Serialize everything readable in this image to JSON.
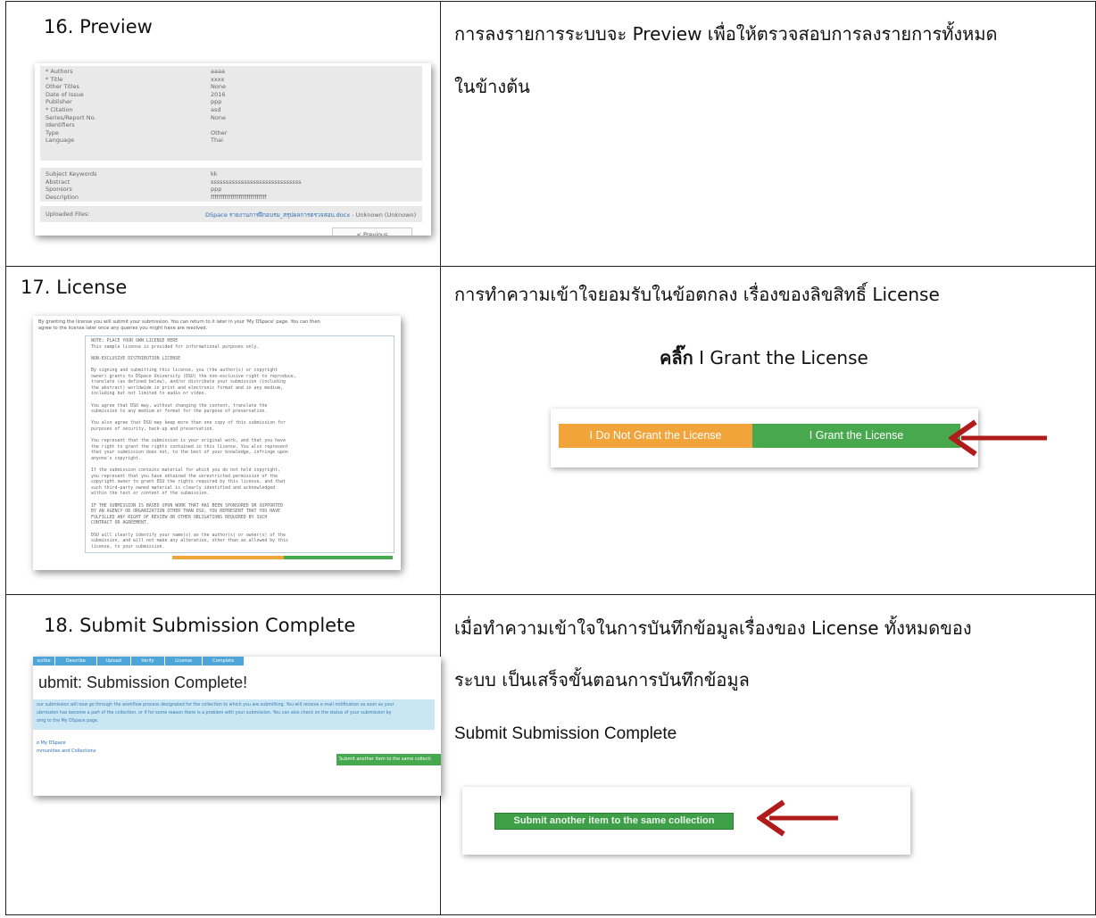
{
  "steps": [
    {
      "title": "16. Preview",
      "desc_lines": [
        "การลงรายการระบบจะ Preview เพื่อให้ตรวจสอบการลงรายการทั้งหมด",
        "ในข้างต้น"
      ],
      "preview": {
        "fields_a": [
          {
            "label": "* Authors",
            "value": "aaaa"
          },
          {
            "label": "* Title",
            "value": "xxxx"
          },
          {
            "label": "Other Titles",
            "value": "None"
          },
          {
            "label": "Date of Issue",
            "value": "2016"
          },
          {
            "label": "Publisher",
            "value": "ppp"
          },
          {
            "label": "* Citation",
            "value": "asd"
          },
          {
            "label": "Series/Report No.",
            "value": "None"
          },
          {
            "label": "Identifiers",
            "value": ""
          },
          {
            "label": "Type",
            "value": "Other"
          },
          {
            "label": "Language",
            "value": "Thai"
          }
        ],
        "fields_b": [
          {
            "label": "Subject Keywords",
            "value": "kk"
          },
          {
            "label": "Abstract",
            "value": "ssssssssssssssssssssssssssssss"
          },
          {
            "label": "Sponsors",
            "value": "ppp"
          },
          {
            "label": "Description",
            "value": "ffffffffffffffffffffffffffff"
          }
        ],
        "uploaded_label": "Uploaded Files:",
        "uploaded_file": "DSpace รายงานการฝึกอบรม_สรุปผลการตรวจสอบ.docx",
        "uploaded_status": " - Unknown (Unknown)",
        "previous_button": "< Previous"
      }
    },
    {
      "title": "17. License",
      "desc": "การทำความเข้าใจยอมรับในข้อตกลง เรื่องของลิขสิทธิ์ License",
      "click_bold": "คลิ๊ก",
      "click_rest": " I Grant the License",
      "license": {
        "intro": [
          "By granting the license you will submit your submission. You can return to it later in your 'My DSpace' page. You can then",
          "agree to the license later once any queries you might have are resolved."
        ],
        "text": [
          "NOTE: PLACE YOUR OWN LICENSE HERE",
          "This sample license is provided for informational purposes only.",
          "",
          "NON-EXCLUSIVE DISTRIBUTION LICENSE",
          "",
          "By signing and submitting this license, you (the author(s) or copyright",
          "owner) grants to DSpace University (DSU) the non-exclusive right to reproduce,",
          "translate (as defined below), and/or distribute your submission (including",
          "the abstract) worldwide in print and electronic format and in any medium,",
          "including but not limited to audio or video.",
          "",
          "You agree that DSU may, without changing the content, translate the",
          "submission to any medium or format for the purpose of preservation.",
          "",
          "You also agree that DSU may keep more than one copy of this submission for",
          "purposes of security, back-up and preservation.",
          "",
          "You represent that the submission is your original work, and that you have",
          "the right to grant the rights contained in this license. You also represent",
          "that your submission does not, to the best of your knowledge, infringe upon",
          "anyone's copyright.",
          "",
          "If the submission contains material for which you do not hold copyright,",
          "you represent that you have obtained the unrestricted permission of the",
          "copyright owner to grant DSU the rights required by this license, and that",
          "such third-party owned material is clearly identified and acknowledged",
          "within the text or content of the submission.",
          "",
          "IF THE SUBMISSION IS BASED UPON WORK THAT HAS BEEN SPONSORED OR SUPPORTED",
          "BY AN AGENCY OR ORGANIZATION OTHER THAN DSU, YOU REPRESENT THAT YOU HAVE",
          "FULFILLED ANY RIGHT OF REVIEW OR OTHER OBLIGATIONS REQUIRED BY SUCH",
          "CONTRACT OR AGREEMENT.",
          "",
          "DSU will clearly identify your name(s) as the author(s) or owner(s) of the",
          "submission, and will not make any alteration, other than as allowed by this",
          "license, to your submission."
        ],
        "do_not_grant": "I Do Not Grant the License",
        "grant": "I Grant the License"
      }
    },
    {
      "title": "18. Submit  Submission Complete",
      "desc_lines": [
        "เมื่อทำความเข้าใจในการบันทึกข้อมูลเรื่องของ License ทั้งหมดของ",
        "ระบบ เป็นเสร็จขั้นตอนการบันทึกข้อมูล"
      ],
      "sub_label": "Submit Submission Complete",
      "complete": {
        "tabs": [
          "scribe",
          "Describe",
          "Upload",
          "Verify",
          "License",
          "Complete"
        ],
        "heading": "ubmit: Submission Complete!",
        "info": [
          "our submission will now go through the workflow process designated for the collection to which you are submitting. You will receive e-mail notification as soon as your",
          "ubmission has become a part of the collection, or if for some reason there is a problem with your submission. You can also check on the status of your submission by",
          "oing to the My DSpace page."
        ],
        "link1": "o My DSpace",
        "link2": "mmunities and Collections",
        "small_button": "Submit another item to the same collecti",
        "big_button": "Submit another item to the same collection"
      }
    }
  ],
  "colors": {
    "orange": "#f0a43a",
    "green": "#48a84e",
    "arrow": "#b01c1c",
    "link": "#2a6db5",
    "infobox": "#c9e6f5",
    "tab": "#4da5d8"
  }
}
